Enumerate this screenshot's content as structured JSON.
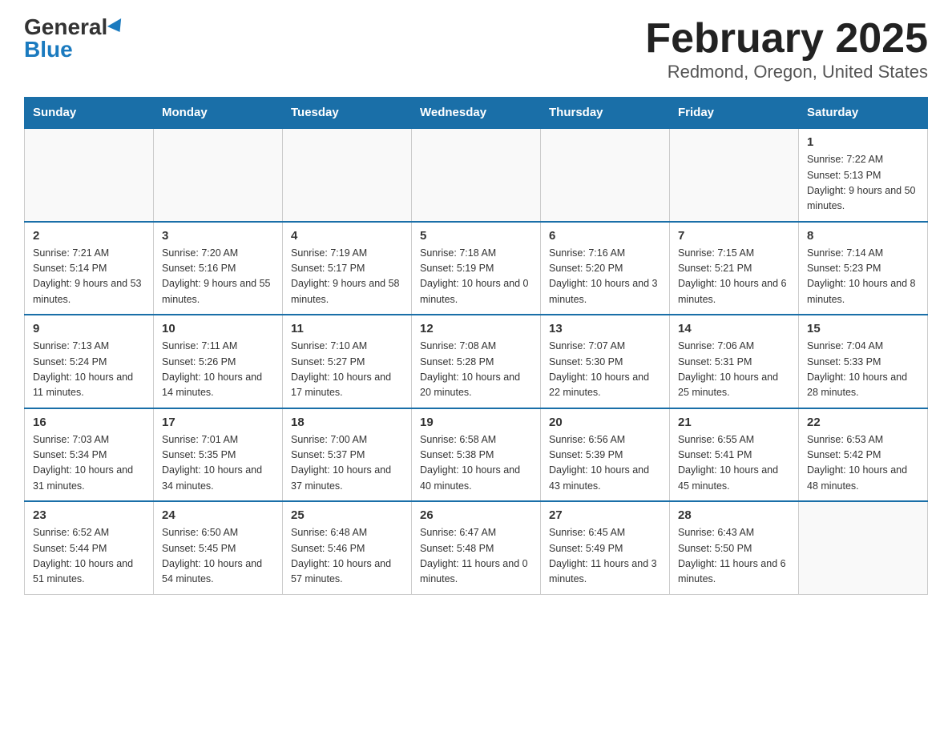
{
  "logo": {
    "general": "General",
    "blue": "Blue"
  },
  "title": "February 2025",
  "subtitle": "Redmond, Oregon, United States",
  "days_of_week": [
    "Sunday",
    "Monday",
    "Tuesday",
    "Wednesday",
    "Thursday",
    "Friday",
    "Saturday"
  ],
  "weeks": [
    [
      {
        "day": "",
        "info": ""
      },
      {
        "day": "",
        "info": ""
      },
      {
        "day": "",
        "info": ""
      },
      {
        "day": "",
        "info": ""
      },
      {
        "day": "",
        "info": ""
      },
      {
        "day": "",
        "info": ""
      },
      {
        "day": "1",
        "info": "Sunrise: 7:22 AM\nSunset: 5:13 PM\nDaylight: 9 hours\nand 50 minutes."
      }
    ],
    [
      {
        "day": "2",
        "info": "Sunrise: 7:21 AM\nSunset: 5:14 PM\nDaylight: 9 hours\nand 53 minutes."
      },
      {
        "day": "3",
        "info": "Sunrise: 7:20 AM\nSunset: 5:16 PM\nDaylight: 9 hours\nand 55 minutes."
      },
      {
        "day": "4",
        "info": "Sunrise: 7:19 AM\nSunset: 5:17 PM\nDaylight: 9 hours\nand 58 minutes."
      },
      {
        "day": "5",
        "info": "Sunrise: 7:18 AM\nSunset: 5:19 PM\nDaylight: 10 hours\nand 0 minutes."
      },
      {
        "day": "6",
        "info": "Sunrise: 7:16 AM\nSunset: 5:20 PM\nDaylight: 10 hours\nand 3 minutes."
      },
      {
        "day": "7",
        "info": "Sunrise: 7:15 AM\nSunset: 5:21 PM\nDaylight: 10 hours\nand 6 minutes."
      },
      {
        "day": "8",
        "info": "Sunrise: 7:14 AM\nSunset: 5:23 PM\nDaylight: 10 hours\nand 8 minutes."
      }
    ],
    [
      {
        "day": "9",
        "info": "Sunrise: 7:13 AM\nSunset: 5:24 PM\nDaylight: 10 hours\nand 11 minutes."
      },
      {
        "day": "10",
        "info": "Sunrise: 7:11 AM\nSunset: 5:26 PM\nDaylight: 10 hours\nand 14 minutes."
      },
      {
        "day": "11",
        "info": "Sunrise: 7:10 AM\nSunset: 5:27 PM\nDaylight: 10 hours\nand 17 minutes."
      },
      {
        "day": "12",
        "info": "Sunrise: 7:08 AM\nSunset: 5:28 PM\nDaylight: 10 hours\nand 20 minutes."
      },
      {
        "day": "13",
        "info": "Sunrise: 7:07 AM\nSunset: 5:30 PM\nDaylight: 10 hours\nand 22 minutes."
      },
      {
        "day": "14",
        "info": "Sunrise: 7:06 AM\nSunset: 5:31 PM\nDaylight: 10 hours\nand 25 minutes."
      },
      {
        "day": "15",
        "info": "Sunrise: 7:04 AM\nSunset: 5:33 PM\nDaylight: 10 hours\nand 28 minutes."
      }
    ],
    [
      {
        "day": "16",
        "info": "Sunrise: 7:03 AM\nSunset: 5:34 PM\nDaylight: 10 hours\nand 31 minutes."
      },
      {
        "day": "17",
        "info": "Sunrise: 7:01 AM\nSunset: 5:35 PM\nDaylight: 10 hours\nand 34 minutes."
      },
      {
        "day": "18",
        "info": "Sunrise: 7:00 AM\nSunset: 5:37 PM\nDaylight: 10 hours\nand 37 minutes."
      },
      {
        "day": "19",
        "info": "Sunrise: 6:58 AM\nSunset: 5:38 PM\nDaylight: 10 hours\nand 40 minutes."
      },
      {
        "day": "20",
        "info": "Sunrise: 6:56 AM\nSunset: 5:39 PM\nDaylight: 10 hours\nand 43 minutes."
      },
      {
        "day": "21",
        "info": "Sunrise: 6:55 AM\nSunset: 5:41 PM\nDaylight: 10 hours\nand 45 minutes."
      },
      {
        "day": "22",
        "info": "Sunrise: 6:53 AM\nSunset: 5:42 PM\nDaylight: 10 hours\nand 48 minutes."
      }
    ],
    [
      {
        "day": "23",
        "info": "Sunrise: 6:52 AM\nSunset: 5:44 PM\nDaylight: 10 hours\nand 51 minutes."
      },
      {
        "day": "24",
        "info": "Sunrise: 6:50 AM\nSunset: 5:45 PM\nDaylight: 10 hours\nand 54 minutes."
      },
      {
        "day": "25",
        "info": "Sunrise: 6:48 AM\nSunset: 5:46 PM\nDaylight: 10 hours\nand 57 minutes."
      },
      {
        "day": "26",
        "info": "Sunrise: 6:47 AM\nSunset: 5:48 PM\nDaylight: 11 hours\nand 0 minutes."
      },
      {
        "day": "27",
        "info": "Sunrise: 6:45 AM\nSunset: 5:49 PM\nDaylight: 11 hours\nand 3 minutes."
      },
      {
        "day": "28",
        "info": "Sunrise: 6:43 AM\nSunset: 5:50 PM\nDaylight: 11 hours\nand 6 minutes."
      },
      {
        "day": "",
        "info": ""
      }
    ]
  ]
}
